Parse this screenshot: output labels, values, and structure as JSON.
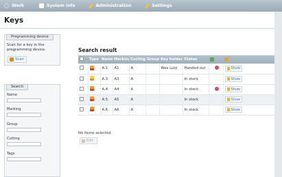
{
  "nav": {
    "items": [
      {
        "label": "Work",
        "icon": "gear-icon"
      },
      {
        "label": "System info",
        "icon": "system-icon"
      },
      {
        "label": "Administration",
        "icon": "wrench-icon"
      },
      {
        "label": "Settings",
        "icon": "wrench-icon"
      }
    ]
  },
  "page": {
    "title": "Keys"
  },
  "programming": {
    "tab": "Programming device",
    "text": "Scan for a key in the programming device.",
    "scan_label": "Scan"
  },
  "search": {
    "tab": "Search",
    "fields": [
      "Name",
      "Marking",
      "Group",
      "Cutting",
      "Tags"
    ]
  },
  "results": {
    "title": "Search result",
    "columns": [
      "",
      "Type",
      "Name",
      "Marking",
      "Cutting",
      "Group",
      "Key holder",
      "Status",
      "",
      ""
    ],
    "rows": [
      {
        "type_color": "orange",
        "name": "A.1",
        "marking": "A1",
        "cutting": "A",
        "group": "",
        "holder": "Wes Lutz",
        "status": "Handed out",
        "deletable": true
      },
      {
        "type_color": "yellow",
        "name": "A.3",
        "marking": "A3",
        "cutting": "A",
        "group": "",
        "holder": "",
        "status": "In stock",
        "deletable": false
      },
      {
        "type_color": "orange",
        "name": "A.4",
        "marking": "A4",
        "cutting": "A",
        "group": "",
        "holder": "",
        "status": "In stock",
        "deletable": true
      },
      {
        "type_color": "orange",
        "name": "A.5",
        "marking": "A5",
        "cutting": "A",
        "group": "",
        "holder": "",
        "status": "In stock",
        "deletable": false
      },
      {
        "type_color": "orange",
        "name": "A.6",
        "marking": "A6",
        "cutting": "A",
        "group": "",
        "holder": "",
        "status": "In stock",
        "deletable": false
      }
    ],
    "show_label": "Show",
    "no_selection": "No items selected",
    "edit_label": "Edit"
  },
  "colors": {
    "header": "#a9b8c3",
    "link": "#2a6fbf",
    "accent": "#e08a1e"
  }
}
